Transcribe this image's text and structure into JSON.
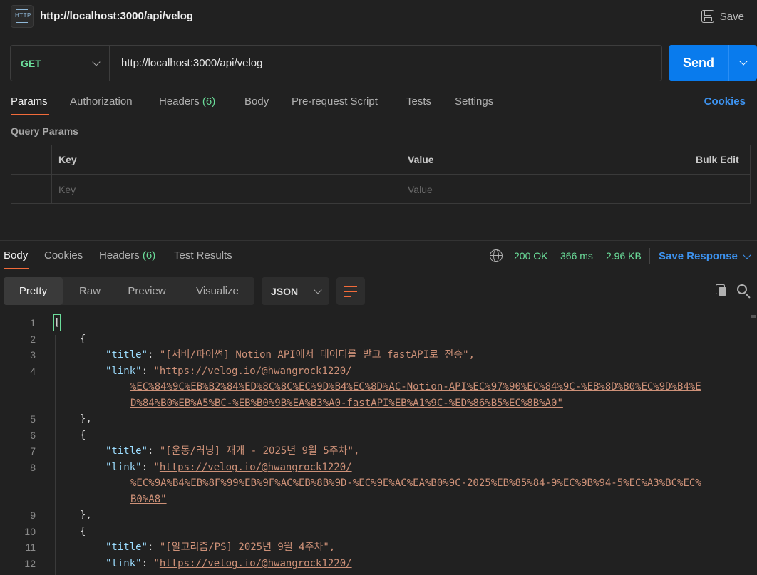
{
  "topbar": {
    "title": "http://localhost:3000/api/velog",
    "icon_text": "HTTP",
    "save_label": "Save"
  },
  "request": {
    "method": "GET",
    "url": "http://localhost:3000/api/velog",
    "send_label": "Send"
  },
  "request_tabs": [
    {
      "label": "Params"
    },
    {
      "label": "Authorization"
    },
    {
      "label": "Headers",
      "count": "(6)"
    },
    {
      "label": "Body"
    },
    {
      "label": "Pre-request Script"
    },
    {
      "label": "Tests"
    },
    {
      "label": "Settings"
    }
  ],
  "cookies_label": "Cookies",
  "query_params": {
    "title": "Query Params",
    "headers": {
      "key": "Key",
      "value": "Value",
      "bulk_edit": "Bulk Edit"
    },
    "placeholders": {
      "key": "Key",
      "value": "Value"
    }
  },
  "response_tabs": [
    {
      "label": "Body"
    },
    {
      "label": "Cookies"
    },
    {
      "label": "Headers",
      "count": "(6)"
    },
    {
      "label": "Test Results"
    }
  ],
  "response_status": {
    "status": "200 OK",
    "time": "366 ms",
    "size": "2.96 KB",
    "save_response": "Save Response"
  },
  "view_modes": [
    "Pretty",
    "Raw",
    "Preview",
    "Visualize"
  ],
  "format": "JSON",
  "colors": {
    "accent_orange": "#f26b3a",
    "status_green": "#6bdd9a",
    "link_blue": "#3d93f0",
    "send_blue": "#097bed"
  },
  "code_lines": [
    {
      "n": "1",
      "text": "["
    },
    {
      "n": "2",
      "text": "{"
    },
    {
      "n": "3",
      "key": "\"title\"",
      "value": "\"[서버/파이썬] Notion API에서 데이터를 받고 fastAPI로 전송\","
    },
    {
      "n": "4",
      "key": "\"link\"",
      "url1": "\"https://velog.io/@hwangrock1220/"
    },
    {
      "n": "",
      "url": "%EC%84%9C%EB%B2%84%ED%8C%8C%EC%9D%B4%EC%8D%AC-Notion-API%EC%97%90%EC%84%9C-%EB%8D%B0%EC%9D%B4%E"
    },
    {
      "n": "",
      "url": "D%84%B0%EB%A5%BC-%EB%B0%9B%EA%B3%A0-fastAPI%EB%A1%9C-%ED%86%B5%EC%8B%A0\""
    },
    {
      "n": "5",
      "text": "},"
    },
    {
      "n": "6",
      "text": "{"
    },
    {
      "n": "7",
      "key": "\"title\"",
      "value": "\"[운동/러닝] 재개 - 2025년 9월 5주차\","
    },
    {
      "n": "8",
      "key": "\"link\"",
      "url1": "\"https://velog.io/@hwangrock1220/"
    },
    {
      "n": "",
      "url": "%EC%9A%B4%EB%8F%99%EB%9F%AC%EB%8B%9D-%EC%9E%AC%EA%B0%9C-2025%EB%85%84-9%EC%9B%94-5%EC%A3%BC%EC%"
    },
    {
      "n": "",
      "url": "B0%A8\""
    },
    {
      "n": "9",
      "text": "},"
    },
    {
      "n": "10",
      "text": "{"
    },
    {
      "n": "11",
      "key": "\"title\"",
      "value": "\"[알고리즘/PS] 2025년 9월 4주차\","
    },
    {
      "n": "12",
      "key": "\"link\"",
      "url1": "\"https://velog.io/@hwangrock1220/"
    }
  ]
}
